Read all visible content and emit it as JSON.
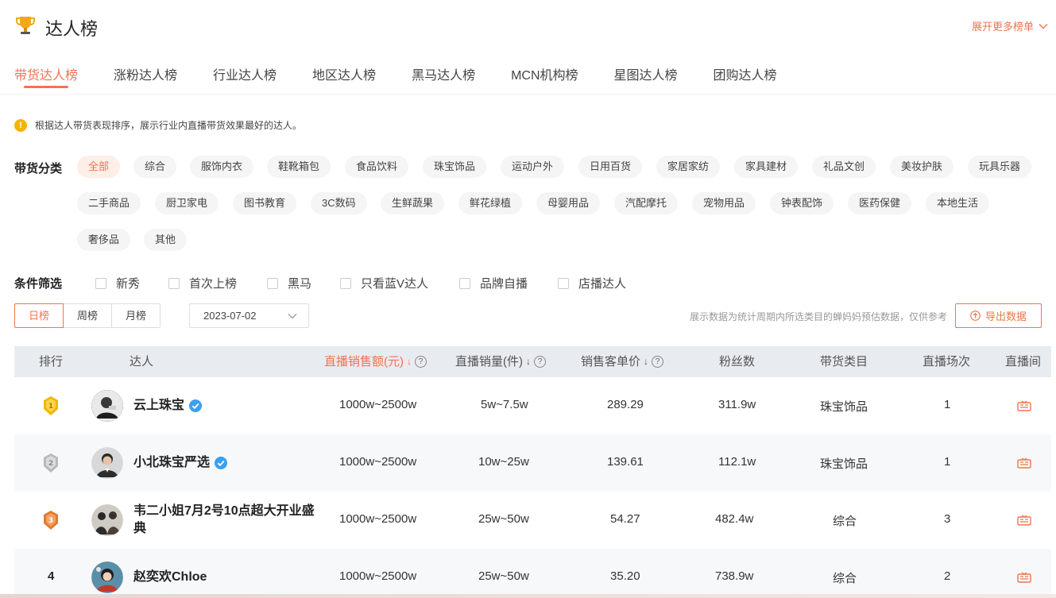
{
  "header": {
    "title": "达人榜",
    "more_lists": "展开更多榜单"
  },
  "tabs": [
    {
      "label": "带货达人榜",
      "active": true
    },
    {
      "label": "涨粉达人榜"
    },
    {
      "label": "行业达人榜"
    },
    {
      "label": "地区达人榜"
    },
    {
      "label": "黑马达人榜"
    },
    {
      "label": "MCN机构榜"
    },
    {
      "label": "星图达人榜"
    },
    {
      "label": "团购达人榜"
    }
  ],
  "notice": "根据达人带货表现排序，展示行业内直播带货效果最好的达人。",
  "categories": {
    "label": "带货分类",
    "items": [
      "全部",
      "综合",
      "服饰内衣",
      "鞋靴箱包",
      "食品饮料",
      "珠宝饰品",
      "运动户外",
      "日用百货",
      "家居家纺",
      "家具建材",
      "礼品文创",
      "美妆护肤",
      "玩具乐器",
      "二手商品",
      "厨卫家电",
      "图书教育",
      "3C数码",
      "生鲜蔬果",
      "鲜花绿植",
      "母婴用品",
      "汽配摩托",
      "宠物用品",
      "钟表配饰",
      "医药保健",
      "本地生活",
      "奢侈品",
      "其他"
    ],
    "active_index": 0
  },
  "filters": {
    "label": "条件筛选",
    "options": [
      "新秀",
      "首次上榜",
      "黑马",
      "只看蓝V达人",
      "品牌自播",
      "店播达人"
    ]
  },
  "period": {
    "options": [
      "日榜",
      "周榜",
      "月榜"
    ],
    "active_index": 0
  },
  "date": "2023-07-02",
  "disclaimer": "展示数据为统计周期内所选类目的蝉妈妈预估数据，仅供参考",
  "export_label": "导出数据",
  "table": {
    "columns": {
      "rank": "排行",
      "talent": "达人",
      "live_sales_amount": "直播销售额(元)",
      "live_sales_volume": "直播销量(件)",
      "avg_price": "销售客单价",
      "fans": "粉丝数",
      "category": "带货类目",
      "sessions": "直播场次",
      "live_room": "直播间"
    },
    "rows": [
      {
        "rank": "1",
        "name": "云上珠宝",
        "verified": true,
        "amount": "1000w~2500w",
        "volume": "5w~7.5w",
        "price": "289.29",
        "fans": "311.9w",
        "category": "珠宝饰品",
        "sessions": "1"
      },
      {
        "rank": "2",
        "name": "小北珠宝严选",
        "verified": true,
        "amount": "1000w~2500w",
        "volume": "10w~25w",
        "price": "139.61",
        "fans": "112.1w",
        "category": "珠宝饰品",
        "sessions": "1"
      },
      {
        "rank": "3",
        "name": "韦二小姐7月2号10点超大开业盛典",
        "verified": false,
        "amount": "1000w~2500w",
        "volume": "25w~50w",
        "price": "54.27",
        "fans": "482.4w",
        "category": "综合",
        "sessions": "3"
      },
      {
        "rank": "4",
        "name": "赵奕欢Chloe",
        "verified": false,
        "amount": "1000w~2500w",
        "volume": "25w~50w",
        "price": "35.20",
        "fans": "738.9w",
        "category": "综合",
        "sessions": "2"
      }
    ]
  },
  "colors": {
    "accent": "#f0744f",
    "gold": "#f6b400",
    "silver": "#b9b9b9",
    "bronze": "#e07a2e",
    "verify": "#3aa0f0"
  },
  "icons": {
    "trophy": "trophy-icon",
    "chevron": "chevron-down-icon",
    "export": "upload-icon",
    "live": "live-icon",
    "verified": "verified-badge-icon"
  }
}
